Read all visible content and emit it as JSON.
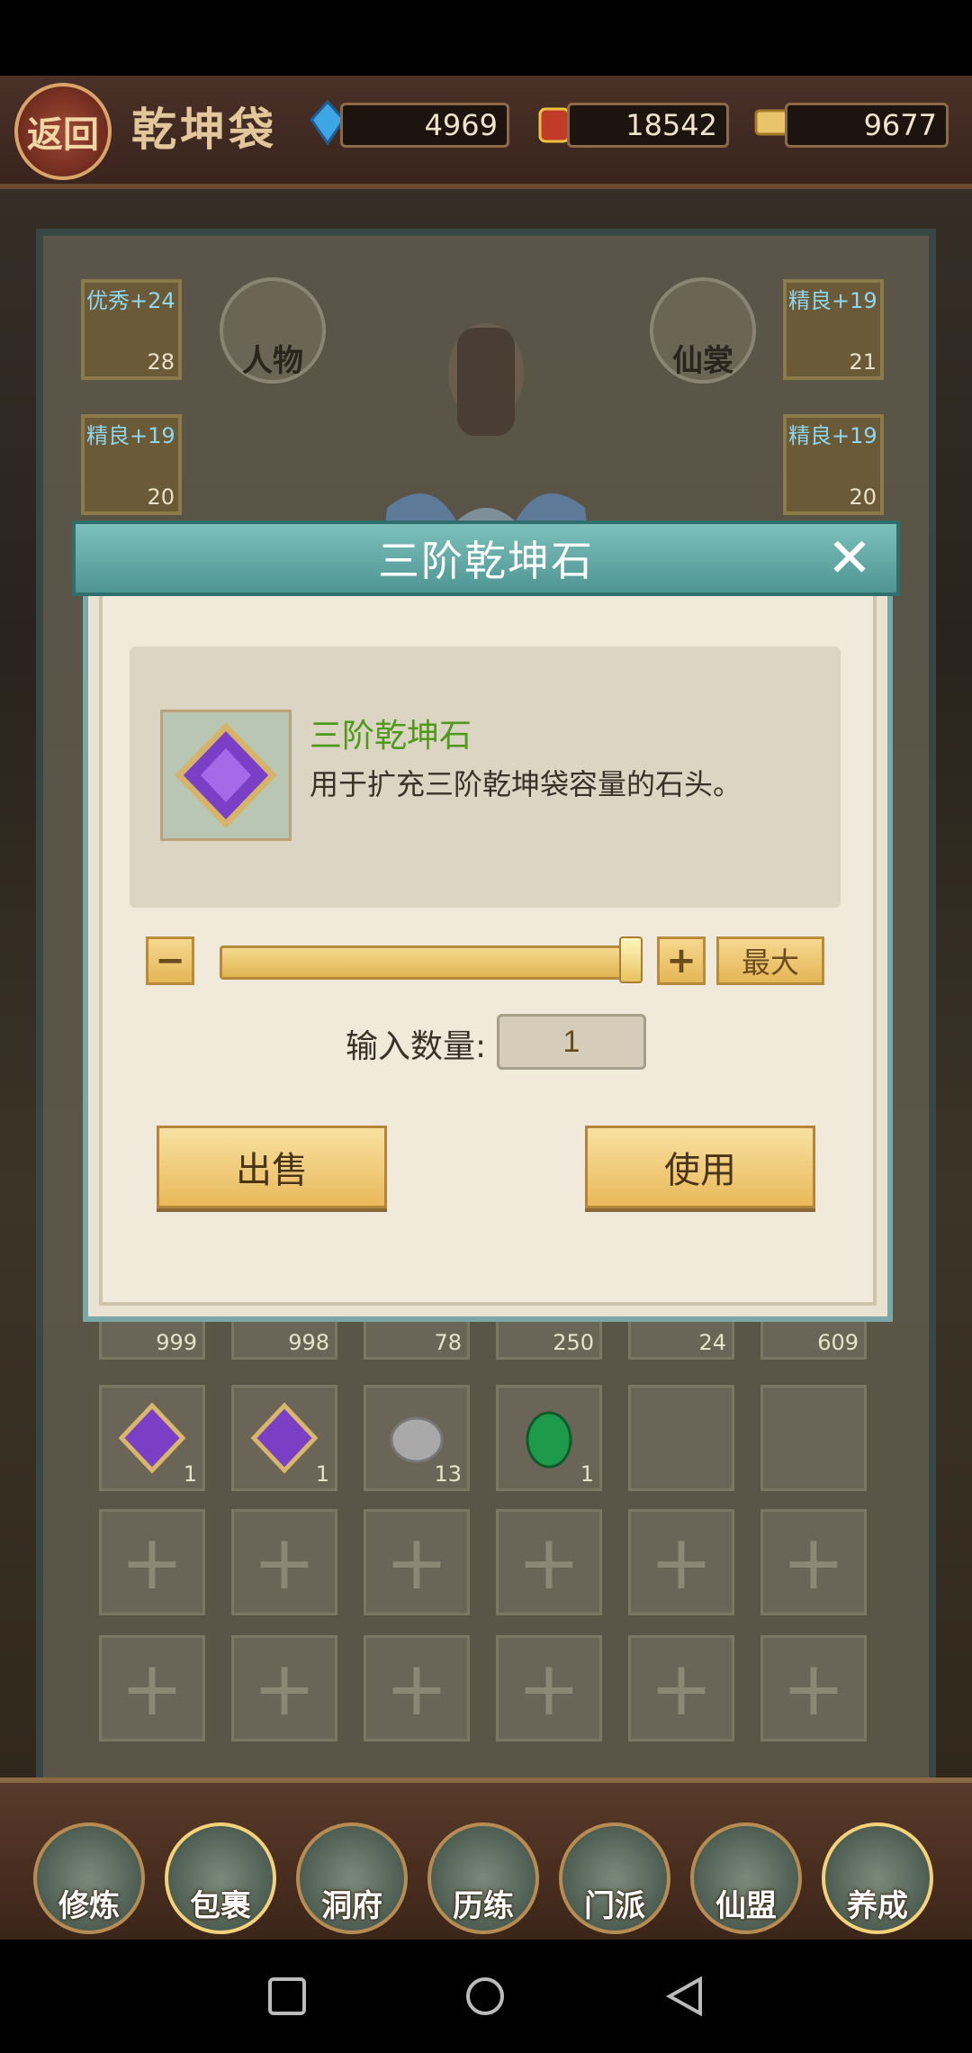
{
  "header": {
    "back_label": "返回",
    "title": "乾坤袋",
    "resources": [
      {
        "icon": "blue-crystal-icon",
        "value": "4969"
      },
      {
        "icon": "red-pouch-icon",
        "value": "18542"
      },
      {
        "icon": "scroll-icon",
        "value": "9677"
      }
    ]
  },
  "equipment": {
    "left_top": {
      "label": "优秀+24",
      "count": "28"
    },
    "left_bottom": {
      "label": "精良+19",
      "count": "20"
    },
    "right_top": {
      "label": "精良+19",
      "count": "21"
    },
    "right_bottom": {
      "label": "精良+19",
      "count": "20"
    },
    "character_button": "人物",
    "costume_button": "仙裳"
  },
  "dialog": {
    "title": "三阶乾坤石",
    "item_name": "三阶乾坤石",
    "item_description": "用于扩充三阶乾坤袋容量的石头。",
    "minus": "−",
    "plus": "+",
    "max_label": "最大",
    "slider_fraction": 1.0,
    "quantity_label": "输入数量:",
    "quantity_value": "1",
    "sell_label": "出售",
    "use_label": "使用"
  },
  "inventory": {
    "partial_row_counts": [
      "999",
      "998",
      "78",
      "250",
      "24",
      "609"
    ],
    "row2_counts": [
      "1",
      "1",
      "13",
      "1",
      "",
      ""
    ]
  },
  "nav": {
    "items": [
      {
        "label": "修炼"
      },
      {
        "label": "包裹"
      },
      {
        "label": "洞府"
      },
      {
        "label": "历练"
      },
      {
        "label": "门派"
      },
      {
        "label": "仙盟"
      },
      {
        "label": "养成"
      }
    ]
  }
}
